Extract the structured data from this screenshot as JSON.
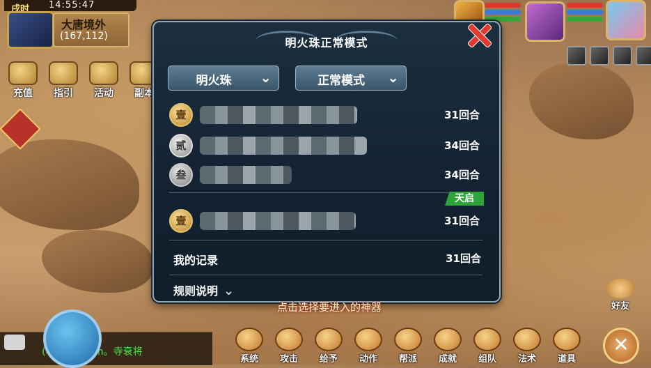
{
  "status": {
    "period": "戌时",
    "time": "14:55:47",
    "location": "大唐境外",
    "coordinates": "(167,112)"
  },
  "left_menu": [
    {
      "label": "充值",
      "icon": "recharge-icon"
    },
    {
      "label": "指引",
      "icon": "guide-icon"
    },
    {
      "label": "活动",
      "icon": "activity-icon"
    },
    {
      "label": "副本",
      "icon": "dungeon-icon"
    }
  ],
  "dialog": {
    "title": "明火珠正常模式",
    "dropdowns": {
      "item": "明火珠",
      "mode": "正常模式"
    },
    "ranking": [
      {
        "rank": "壹",
        "rounds": "31回合"
      },
      {
        "rank": "贰",
        "rounds": "34回合"
      },
      {
        "rank": "叁",
        "rounds": "34回合"
      }
    ],
    "badge": "天启",
    "my_entry": {
      "rank": "壹",
      "rounds": "31回合"
    },
    "my_record_label": "我的记录",
    "my_record_rounds": "31回合",
    "rules_label": "规则说明"
  },
  "hint": "点击选择要进入的神器",
  "chat": {
    "text": "(收徒副本)Fm。寺衰将"
  },
  "bottom_menu": [
    {
      "label": "系统",
      "icon": "system-icon"
    },
    {
      "label": "攻击",
      "icon": "attack-icon"
    },
    {
      "label": "给予",
      "icon": "give-icon"
    },
    {
      "label": "动作",
      "icon": "action-icon"
    },
    {
      "label": "帮派",
      "icon": "guild-icon"
    },
    {
      "label": "成就",
      "icon": "achievement-icon"
    },
    {
      "label": "组队",
      "icon": "team-icon"
    },
    {
      "label": "法术",
      "icon": "magic-icon"
    },
    {
      "label": "道具",
      "icon": "item-icon"
    }
  ],
  "friend_label": "好友",
  "colors": {
    "dialog_bg": "#142434",
    "badge_green": "#2fa43a",
    "close_red": "#e23a2e"
  }
}
